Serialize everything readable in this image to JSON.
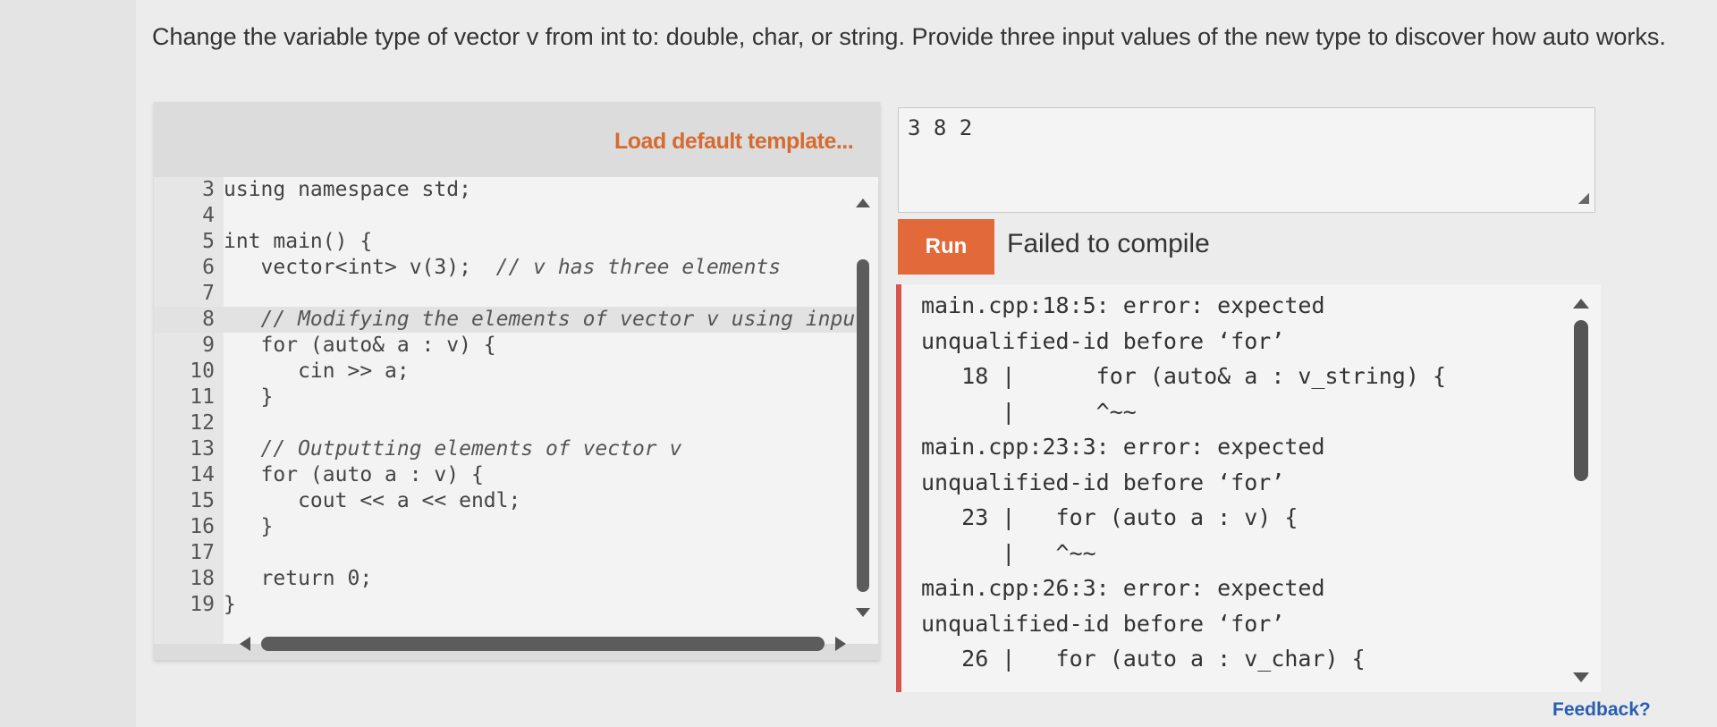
{
  "instructions": "Change the variable type of vector v from int to: double, char, or string. Provide three input values of the new type to discover how auto works.",
  "editor": {
    "load_template_label": "Load default template...",
    "lines": [
      {
        "no": "3",
        "text": "using namespace std;",
        "comment": false
      },
      {
        "no": "4",
        "text": "",
        "comment": false
      },
      {
        "no": "5",
        "text": "int main() {",
        "comment": false
      },
      {
        "no": "6",
        "text": "   vector<int> v(3);  ",
        "tail": "// v has three elements",
        "comment": false
      },
      {
        "no": "7",
        "text": "",
        "comment": false
      },
      {
        "no": "8",
        "text": "   ",
        "tail": "// Modifying the elements of vector v using inpu",
        "comment": false
      },
      {
        "no": "9",
        "text": "   for (auto& a : v) {",
        "comment": false
      },
      {
        "no": "10",
        "text": "      cin >> a;",
        "comment": false
      },
      {
        "no": "11",
        "text": "   }",
        "comment": false
      },
      {
        "no": "12",
        "text": "",
        "comment": false
      },
      {
        "no": "13",
        "text": "   ",
        "tail": "// Outputting elements of vector v",
        "comment": false
      },
      {
        "no": "14",
        "text": "   for (auto a : v) {",
        "comment": false
      },
      {
        "no": "15",
        "text": "      cout << a << endl;",
        "comment": false
      },
      {
        "no": "16",
        "text": "   }",
        "comment": false
      },
      {
        "no": "17",
        "text": "",
        "comment": false
      },
      {
        "no": "18",
        "text": "   return 0;",
        "comment": false
      },
      {
        "no": "19",
        "text": "}",
        "comment": false
      }
    ]
  },
  "input": {
    "value": "3 8 2"
  },
  "run": {
    "label": "Run",
    "status": "Failed to compile"
  },
  "output": {
    "lines": [
      "main.cpp:18:5: error: expected",
      "unqualified-id before ‘for’",
      "   18 |      for (auto& a : v_string) {",
      "      |      ^~~",
      "main.cpp:23:3: error: expected",
      "unqualified-id before ‘for’",
      "   23 |   for (auto a : v) {",
      "      |   ^~~",
      "main.cpp:26:3: error: expected",
      "unqualified-id before ‘for’",
      "   26 |   for (auto a : v_char) {"
    ]
  },
  "feedback_label": "Feedback?",
  "colors": {
    "accent": "#e2693a",
    "error_border": "#d9534f",
    "link": "#2a5db0",
    "template_link": "#d56b30"
  }
}
